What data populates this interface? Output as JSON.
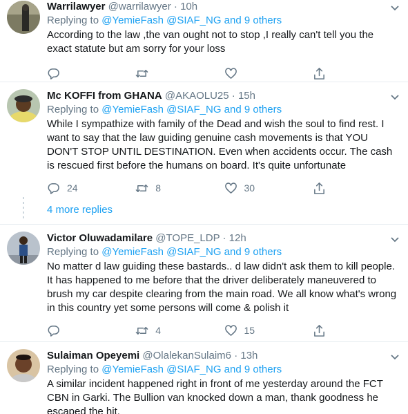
{
  "tweets": [
    {
      "name": "Warrilawyer",
      "handle": "@warrilawyer",
      "time": "· 10h",
      "replying_prefix": "Replying to ",
      "replying_to": "@YemieFash @SIAF_NG and 9 others",
      "text": "According to the law ,the van ought not to stop ,I really can't tell you the exact statute but am sorry for your loss",
      "replies": "",
      "retweets": "",
      "likes": ""
    },
    {
      "name": "Mc KOFFI from GHANA",
      "handle": "@AKAOLU25",
      "time": "· 15h",
      "replying_prefix": "Replying to ",
      "replying_to": "@YemieFash @SIAF_NG and 9 others",
      "text": "While I sympathize with family of the Dead and wish the soul to find rest.  I want to say that the law guiding genuine cash movements is that YOU DON'T STOP UNTIL DESTINATION. Even when accidents occur. The cash is rescued first before the humans on board. It's quite unfortunate",
      "replies": "24",
      "retweets": "8",
      "likes": "30"
    },
    {
      "name": "Victor Oluwadamilare",
      "handle": "@TOPE_LDP",
      "time": "· 12h",
      "replying_prefix": "Replying to ",
      "replying_to": "@YemieFash @SIAF_NG and 9 others",
      "text": "No matter d law guiding these bastards.. d law didn't ask them to kill people. It has happened to me before that the driver deliberately maneuvered to brush my car despite clearing from the main road. We all know what's wrong in this country yet some persons will come & polish it",
      "replies": "",
      "retweets": "4",
      "likes": "15"
    },
    {
      "name": "Sulaiman Opeyemi",
      "handle": "@OlalekanSulaim6",
      "time": "· 13h",
      "replying_prefix": "Replying to ",
      "replying_to": "@YemieFash @SIAF_NG and 9 others",
      "text": "A similar incident happened right in front of me yesterday around the FCT CBN in Garki. The Bullion van knocked down a man, thank goodness he escaped the hit."
    }
  ],
  "more_replies": "4 more replies",
  "icons": {
    "reply": "reply-icon",
    "retweet": "retweet-icon",
    "like": "heart-icon",
    "share": "share-icon",
    "menu": "chevron-down-icon"
  },
  "colors": {
    "link": "#1da1f2",
    "secondary": "#657786",
    "border": "#e6ecf0"
  }
}
